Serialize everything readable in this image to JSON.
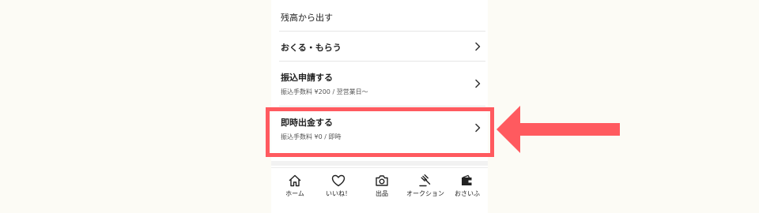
{
  "menu": {
    "balance_out": {
      "title": "残高から出す"
    },
    "send_receive": {
      "title": "おくる・もらう"
    },
    "transfer_request": {
      "title": "振込申請する",
      "sub": "振込手数料 ¥200 / 翌営業日〜"
    },
    "instant_withdraw": {
      "title": "即時出金する",
      "sub": "振込手数料 ¥0 / 即時"
    }
  },
  "tabbar": {
    "home": "ホーム",
    "like": "いいね！",
    "listing": "出品",
    "auction": "オークション",
    "wallet": "おさいふ"
  },
  "colors": {
    "highlight": "#ff5a5f",
    "background": "#fcfbf5"
  },
  "icons": [
    "chevron-right-icon",
    "home-icon",
    "heart-icon",
    "camera-icon",
    "gavel-icon",
    "wallet-icon",
    "arrow-left-icon"
  ]
}
